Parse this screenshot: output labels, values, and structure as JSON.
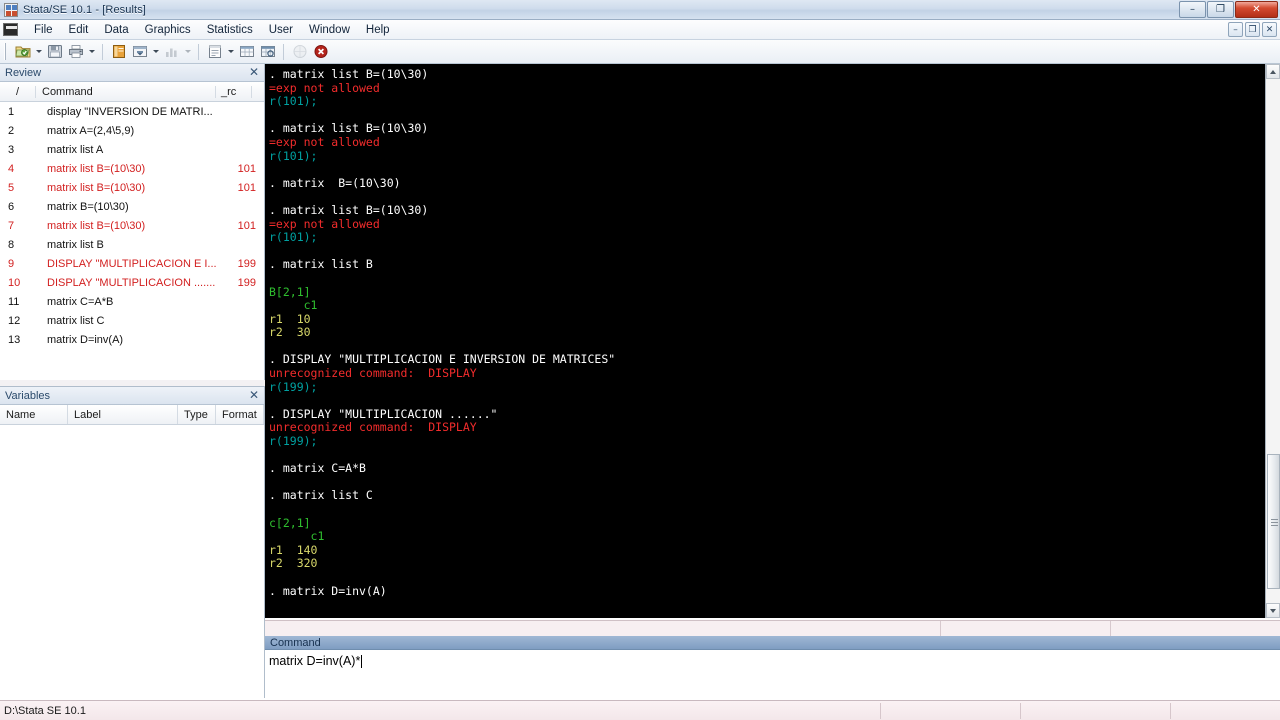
{
  "window": {
    "title": "Stata/SE 10.1 - [Results]",
    "app_icon": "stata-logo-icon",
    "controls": {
      "minimize": "–",
      "maximize": "❐",
      "close": "✕"
    },
    "mdi_controls": {
      "minimize": "–",
      "restore": "❐",
      "close": "✕"
    }
  },
  "menu": {
    "items": [
      "File",
      "Edit",
      "Data",
      "Graphics",
      "Statistics",
      "User",
      "Window",
      "Help"
    ]
  },
  "toolbar": {
    "buttons": [
      {
        "name": "open-file-button",
        "icon": "open-folder-icon",
        "dropdown": true,
        "disabled": false
      },
      {
        "name": "save-button",
        "icon": "floppy-disk-icon",
        "dropdown": false,
        "disabled": false
      },
      {
        "name": "print-button",
        "icon": "printer-icon",
        "dropdown": true,
        "disabled": false
      },
      {
        "name": "log-button",
        "icon": "log-book-icon",
        "dropdown": false,
        "disabled": false
      },
      {
        "name": "viewer-button",
        "icon": "viewer-window-icon",
        "dropdown": true,
        "disabled": false
      },
      {
        "name": "graph-button",
        "icon": "bar-chart-icon",
        "dropdown": true,
        "disabled": true
      },
      {
        "name": "do-editor-button",
        "icon": "do-file-editor-icon",
        "dropdown": true,
        "disabled": false
      },
      {
        "name": "data-editor-button",
        "icon": "data-editor-icon",
        "dropdown": false,
        "disabled": false
      },
      {
        "name": "data-browser-button",
        "icon": "data-browser-icon",
        "dropdown": false,
        "disabled": false
      },
      {
        "name": "more-button",
        "icon": "circle-icon",
        "dropdown": false,
        "disabled": true
      },
      {
        "name": "break-button",
        "icon": "break-stop-icon",
        "dropdown": false,
        "disabled": false
      }
    ]
  },
  "review": {
    "title": "Review",
    "close_label": "✕",
    "columns": {
      "index": "/",
      "command": "Command",
      "rc": "_rc"
    },
    "rows": [
      {
        "n": "1",
        "cmd": "display \"INVERSION DE MATRI...",
        "rc": "",
        "error": false
      },
      {
        "n": "2",
        "cmd": "matrix A=(2,4\\5,9)",
        "rc": "",
        "error": false
      },
      {
        "n": "3",
        "cmd": "matrix list A",
        "rc": "",
        "error": false
      },
      {
        "n": "4",
        "cmd": "matrix list B=(10\\30)",
        "rc": "101",
        "error": true
      },
      {
        "n": "5",
        "cmd": "matrix list B=(10\\30)",
        "rc": "101",
        "error": true
      },
      {
        "n": "6",
        "cmd": "matrix  B=(10\\30)",
        "rc": "",
        "error": false
      },
      {
        "n": "7",
        "cmd": "matrix list B=(10\\30)",
        "rc": "101",
        "error": true
      },
      {
        "n": "8",
        "cmd": "matrix list B",
        "rc": "",
        "error": false
      },
      {
        "n": "9",
        "cmd": "DISPLAY \"MULTIPLICACION E I...",
        "rc": "199",
        "error": true
      },
      {
        "n": "10",
        "cmd": "DISPLAY \"MULTIPLICACION .......",
        "rc": "199",
        "error": true
      },
      {
        "n": "11",
        "cmd": "matrix C=A*B",
        "rc": "",
        "error": false
      },
      {
        "n": "12",
        "cmd": "matrix list C",
        "rc": "",
        "error": false
      },
      {
        "n": "13",
        "cmd": "matrix D=inv(A)",
        "rc": "",
        "error": false
      }
    ]
  },
  "variables": {
    "title": "Variables",
    "close_label": "✕",
    "columns": [
      "Name",
      "Label",
      "Type",
      "Format"
    ],
    "rows": []
  },
  "results": {
    "lines": [
      {
        "text": ". matrix list B=(10\\30)",
        "kind": "cmd"
      },
      {
        "text": "=exp not allowed",
        "kind": "err"
      },
      {
        "text": "r(101);",
        "kind": "rc"
      },
      {
        "text": "",
        "kind": "blank"
      },
      {
        "text": ". matrix list B=(10\\30)",
        "kind": "cmd"
      },
      {
        "text": "=exp not allowed",
        "kind": "err"
      },
      {
        "text": "r(101);",
        "kind": "rc"
      },
      {
        "text": "",
        "kind": "blank"
      },
      {
        "text": ". matrix  B=(10\\30)",
        "kind": "cmd"
      },
      {
        "text": "",
        "kind": "blank"
      },
      {
        "text": ". matrix list B=(10\\30)",
        "kind": "cmd"
      },
      {
        "text": "=exp not allowed",
        "kind": "err"
      },
      {
        "text": "r(101);",
        "kind": "rc"
      },
      {
        "text": "",
        "kind": "blank"
      },
      {
        "text": ". matrix list B",
        "kind": "cmd"
      },
      {
        "text": "",
        "kind": "blank"
      },
      {
        "text": "B[2,1]",
        "kind": "res"
      },
      {
        "text": "     c1",
        "kind": "res"
      },
      {
        "text": "r1  10",
        "kind": "val"
      },
      {
        "text": "r2  30",
        "kind": "val"
      },
      {
        "text": "",
        "kind": "blank"
      },
      {
        "text": ". DISPLAY \"MULTIPLICACION E INVERSION DE MATRICES\"",
        "kind": "cmd"
      },
      {
        "text": "unrecognized command:  DISPLAY",
        "kind": "err"
      },
      {
        "text": "r(199);",
        "kind": "rc"
      },
      {
        "text": "",
        "kind": "blank"
      },
      {
        "text": ". DISPLAY \"MULTIPLICACION ......\"",
        "kind": "cmd"
      },
      {
        "text": "unrecognized command:  DISPLAY",
        "kind": "err"
      },
      {
        "text": "r(199);",
        "kind": "rc"
      },
      {
        "text": "",
        "kind": "blank"
      },
      {
        "text": ". matrix C=A*B",
        "kind": "cmd"
      },
      {
        "text": "",
        "kind": "blank"
      },
      {
        "text": ". matrix list C",
        "kind": "cmd"
      },
      {
        "text": "",
        "kind": "blank"
      },
      {
        "text": "c[2,1]",
        "kind": "res"
      },
      {
        "text": "      c1",
        "kind": "res"
      },
      {
        "text": "r1  140",
        "kind": "val"
      },
      {
        "text": "r2  320",
        "kind": "val"
      },
      {
        "text": "",
        "kind": "blank"
      },
      {
        "text": ". matrix D=inv(A)",
        "kind": "cmd"
      },
      {
        "text": "",
        "kind": "blank"
      },
      {
        "text": ".",
        "kind": "cmd"
      }
    ]
  },
  "command": {
    "title": "Command",
    "value": "matrix D=inv(A)*",
    "placeholder": ""
  },
  "status": {
    "path": "D:\\Stata SE 10.1"
  },
  "colors": {
    "console_bg": "#000000",
    "command_text": "#ffffff",
    "error_text": "#f22c2c",
    "return_code_text": "#00a0a0",
    "result_text": "#2fbf2f",
    "value_text": "#d8d86a",
    "review_error": "#d21f1f",
    "command_titlebar": "#8fa9c9"
  }
}
